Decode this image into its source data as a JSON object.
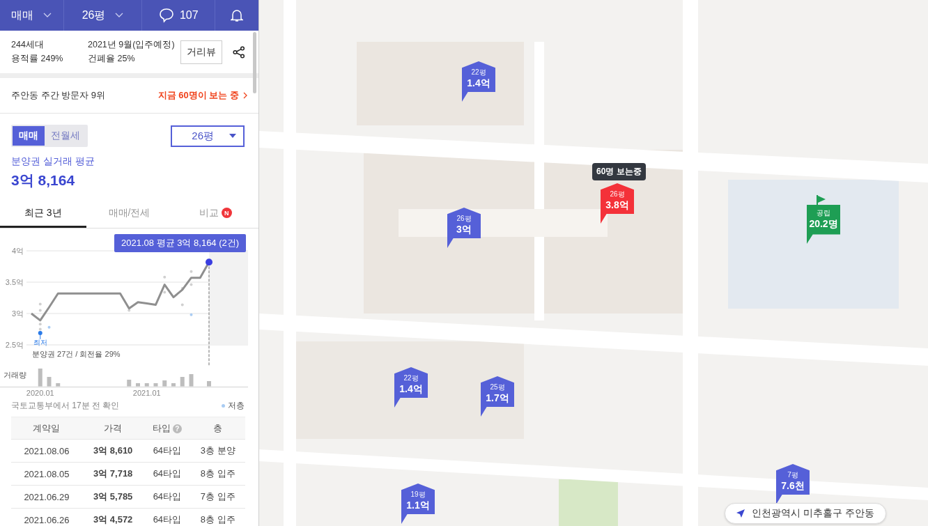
{
  "header": {
    "deal_type": "매매",
    "size": "26평",
    "comment_count": "107"
  },
  "summary": {
    "households": "244세대",
    "floor_area_ratio": "용적률 249%",
    "move_in": "2021년 9월(입주예정)",
    "building_coverage": "건폐율 25%",
    "street_view_button": "거리뷰"
  },
  "visitors": {
    "rank": "주안동 주간 방문자 9위",
    "live": "지금 60명이 보는 중"
  },
  "deal_tabs": [
    {
      "label": "매매",
      "selected": true
    },
    {
      "label": "전월세",
      "selected": false
    }
  ],
  "size_select": "26평",
  "average": {
    "label": "분양권 실거래 평균",
    "value": "3억 8,164"
  },
  "period_tabs": [
    {
      "label": "최근 3년",
      "selected": true
    },
    {
      "label": "매매/전세",
      "selected": false
    },
    {
      "label": "비교",
      "selected": false,
      "badge": "N"
    }
  ],
  "chart": {
    "tooltip": "2021.08 평균 3억 8,164 (2건)",
    "low_label": "최저",
    "note": "분양권 27건 / 회전율 29%",
    "volume_label": "거래량",
    "chart_data": {
      "type": "line",
      "categories": [
        null,
        "2020.01",
        null,
        null,
        null,
        null,
        null,
        null,
        null,
        null,
        null,
        null,
        null,
        "2021.01",
        null,
        null,
        null,
        null,
        null,
        null,
        null
      ],
      "series": [
        {
          "color": "#8f8f8f",
          "values": [
            3.0,
            2.89,
            3.1,
            3.32,
            3.32,
            3.32,
            3.32,
            3.32,
            3.32,
            3.32,
            3.32,
            3.08,
            3.18,
            3.16,
            3.14,
            3.46,
            3.26,
            3.38,
            3.57,
            3.57,
            3.82
          ]
        }
      ],
      "ylim": [
        2.5,
        4
      ],
      "yticks": [
        {
          "value": 4,
          "label": "4억"
        },
        {
          "value": 3.5,
          "label": "3.5억"
        },
        {
          "value": 3,
          "label": "3억"
        },
        {
          "value": 2.5,
          "label": "2.5억"
        }
      ]
    }
  },
  "source": "국토교통부에서 17분 전 확인",
  "legend": "저층",
  "table": {
    "columns": [
      {
        "label": "계약일"
      },
      {
        "label": "가격"
      },
      {
        "label": "타입",
        "help": "?"
      },
      {
        "label": "층"
      }
    ],
    "rows": [
      [
        "2021.08.06",
        "3억 8,610",
        "64타입",
        "3층 분양"
      ],
      [
        "2021.08.05",
        "3억 7,718",
        "64타입",
        "8층 입주"
      ],
      [
        "2021.06.29",
        "3억 5,785",
        "64타입",
        "7층 입주"
      ],
      [
        "2021.06.26",
        "3억 4,572",
        "64타입",
        "8층 입주"
      ]
    ]
  },
  "map": {
    "markers": [
      {
        "kind": "price",
        "size": "22평",
        "price": "1.4억",
        "selected": false
      },
      {
        "kind": "price",
        "size": "26평",
        "price": "3.8억",
        "selected": true,
        "viewers": "60명 보는중"
      },
      {
        "kind": "price",
        "size": "26평",
        "price": "3억",
        "selected": false
      },
      {
        "kind": "price",
        "size": "22평",
        "price": "1.4억",
        "selected": false
      },
      {
        "kind": "price",
        "size": "25평",
        "price": "1.7억",
        "selected": false
      },
      {
        "kind": "price",
        "size": "19평",
        "price": "1.1억",
        "selected": false
      },
      {
        "kind": "price",
        "size": "7평",
        "price": "7.6천",
        "selected": false
      },
      {
        "kind": "school",
        "size": "공립",
        "price": "20.2명"
      }
    ],
    "location": "인천광역시 미추홀구 주안동"
  }
}
